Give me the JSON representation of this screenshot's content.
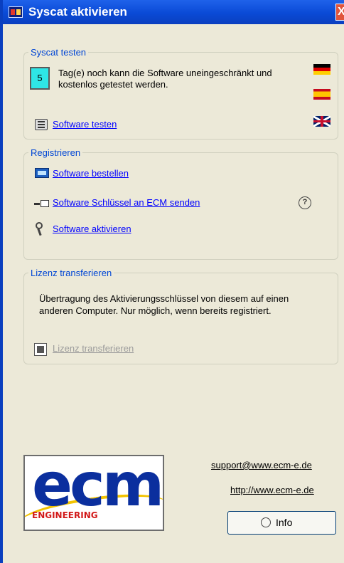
{
  "window": {
    "title": "Syscat aktivieren",
    "close_glyph": "X"
  },
  "sections": {
    "test": {
      "legend": "Syscat testen",
      "days_remaining": "5",
      "trial_text": "Tag(e) noch kann die Software uneingeschränkt und kostenlos getestet werden.",
      "test_link": "Software testen",
      "icon": "computer-icon"
    },
    "register": {
      "legend": "Registrieren",
      "order_link": "Software bestellen",
      "send_key_link": "Software Schlüssel an ECM senden",
      "activate_link": "Software aktivieren",
      "help_icon": "help-speech-icon"
    },
    "transfer": {
      "legend": "Lizenz transferieren",
      "description": "Übertragung des Aktivierungsschlüssel von diesem auf einen anderen Computer. Nur möglich, wenn bereits registriert.",
      "transfer_link": "Lizenz transferieren",
      "transfer_enabled": false
    }
  },
  "languages": [
    {
      "name": "Deutsch",
      "flag": "flag-de"
    },
    {
      "name": "Español",
      "flag": "flag-es"
    },
    {
      "name": "English",
      "flag": "flag-uk"
    }
  ],
  "footer": {
    "logo_text": "ecm",
    "logo_subtext": "ENGINEERING",
    "support_email": "support@www.ecm-e.de",
    "website": "http://www.ecm-e.de",
    "info_button": "Info"
  },
  "colors": {
    "titlebar": "#0a4ad6",
    "legend": "#0046d5",
    "link": "#0000ff",
    "counter_bg": "#2ee6e6",
    "logo_blue": "#0b2f9e",
    "logo_red": "#d21a1a"
  }
}
